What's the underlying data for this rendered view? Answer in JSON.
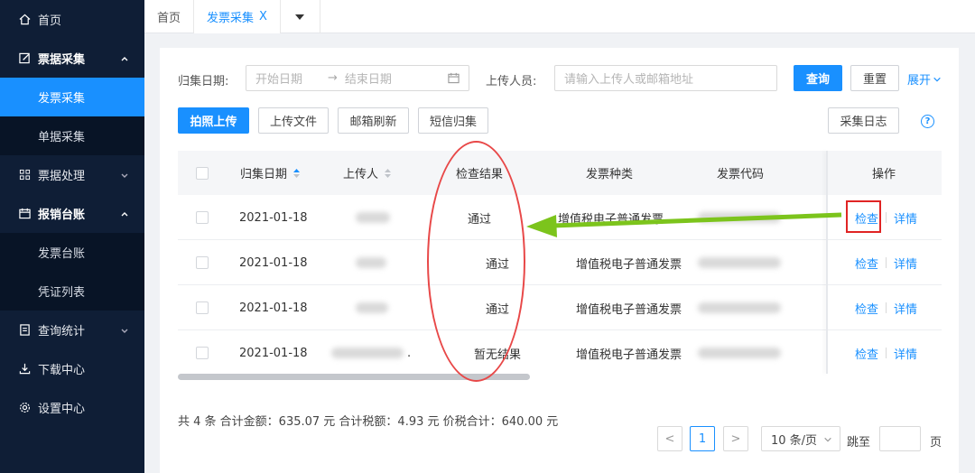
{
  "sidebar": {
    "items": [
      {
        "label": "首页",
        "icon": "home-icon"
      },
      {
        "label": "票据采集",
        "icon": "edit-icon",
        "open": true
      },
      {
        "label": "发票采集",
        "active": true
      },
      {
        "label": "单据采集"
      },
      {
        "label": "票据处理",
        "icon": "grid-icon"
      },
      {
        "label": "报销台账",
        "icon": "calendar-icon",
        "open": true
      },
      {
        "label": "发票台账"
      },
      {
        "label": "凭证列表"
      },
      {
        "label": "查询统计",
        "icon": "report-icon"
      },
      {
        "label": "下载中心",
        "icon": "download-icon"
      },
      {
        "label": "设置中心",
        "icon": "gear-icon"
      }
    ]
  },
  "tabs": {
    "home": "首页",
    "active": "发票采集",
    "close": "X"
  },
  "filters": {
    "date_label": "归集日期:",
    "start_placeholder": "开始日期",
    "arrow": "→",
    "end_placeholder": "结束日期",
    "uploader_label": "上传人员:",
    "uploader_placeholder": "请输入上传人或邮箱地址",
    "query": "查询",
    "reset": "重置",
    "expand": "展开"
  },
  "actions": {
    "photo_upload": "拍照上传",
    "upload_file": "上传文件",
    "mailbox_refresh": "邮箱刷新",
    "sms_collect": "短信归集",
    "collect_log": "采集日志",
    "help": "?"
  },
  "table": {
    "headers": {
      "date": "归集日期",
      "uploader": "上传人",
      "result": "检查结果",
      "type": "发票种类",
      "code": "发票代码",
      "ops": "操作"
    },
    "rows": [
      {
        "date": "2021-01-18",
        "result": "通过",
        "type": "增值税电子普通发票",
        "check": "检查",
        "detail": "详情"
      },
      {
        "date": "2021-01-18",
        "result": "通过",
        "type": "增值税电子普通发票",
        "check": "检查",
        "detail": "详情"
      },
      {
        "date": "2021-01-18",
        "result": "通过",
        "type": "增值税电子普通发票",
        "check": "检查",
        "detail": "详情"
      },
      {
        "date": "2021-01-18",
        "uploader_suffix": ".",
        "result": "暂无结果",
        "type": "增值税电子普通发票",
        "check": "检查",
        "detail": "详情"
      }
    ]
  },
  "summary": "共 4 条 合计金额：635.07 元 合计税额：4.93 元 价税合计：640.00 元",
  "pagination": {
    "prev": "<",
    "current": "1",
    "next": ">",
    "page_size": "10 条/页",
    "jump_label": "跳至",
    "page_unit": "页"
  },
  "colors": {
    "accent": "#1990ff",
    "sidebar_bg": "#0f1e36",
    "annotation_red": "#e02424",
    "annotation_arrow": "#7cc41c"
  }
}
